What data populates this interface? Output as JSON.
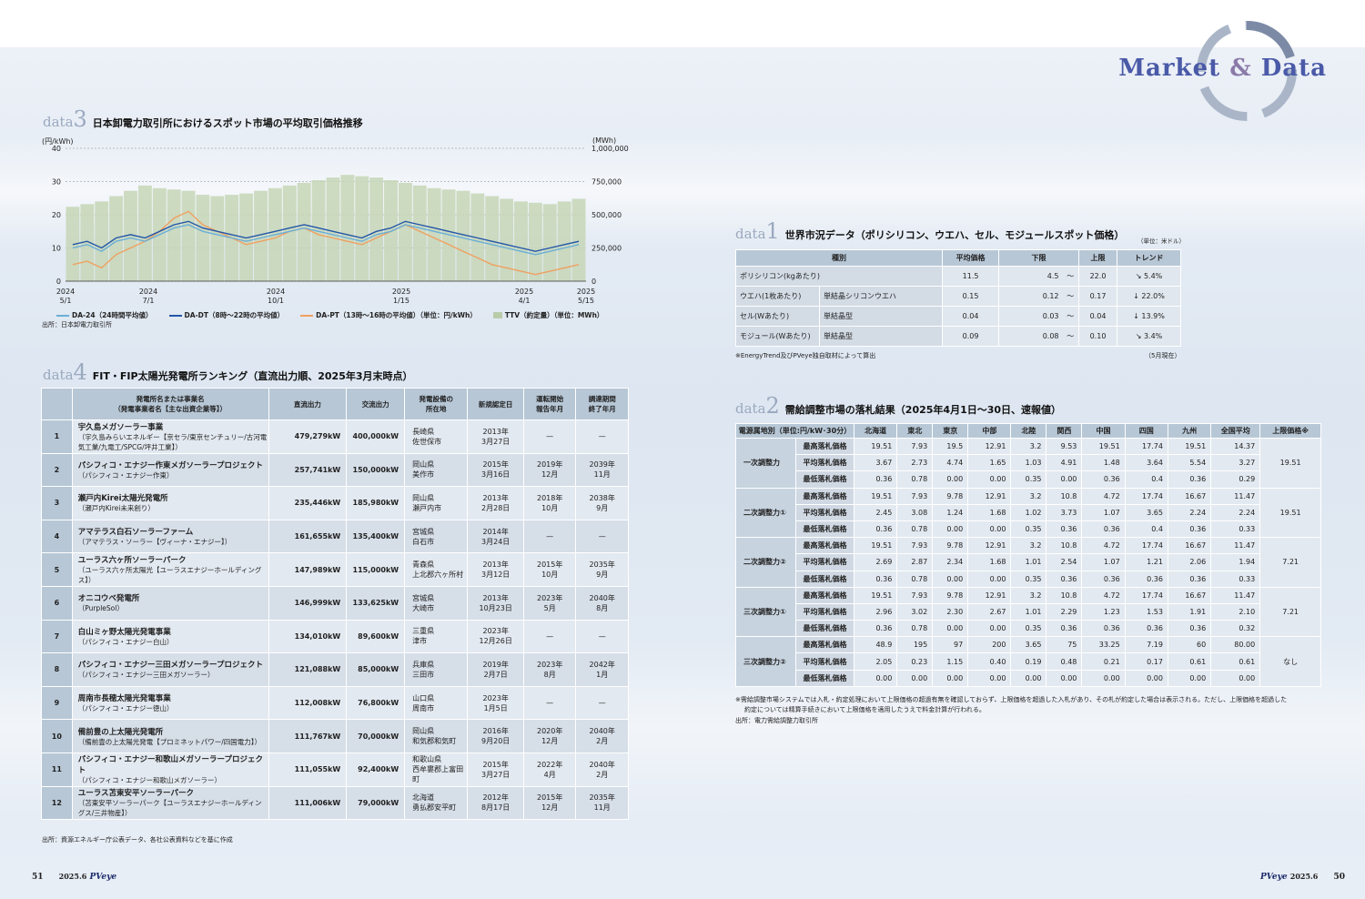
{
  "header": {
    "brand_market": "Market",
    "brand_amp": "&",
    "brand_data": "Data"
  },
  "data3": {
    "tag": "data",
    "num": "3",
    "title": "日本卸電力取引所におけるスポット市場の平均取引価格推移",
    "left_unit": "(円/kWh)",
    "right_unit": "(MWh)",
    "source": "出所：日本卸電力取引所",
    "legend": [
      {
        "label": "DA-24（24時間平均値）",
        "color": "#6aaed6"
      },
      {
        "label": "DA-DT（8時〜22時の平均値）",
        "color": "#2356a8"
      },
      {
        "label": "DA-PT（13時〜16時の平均値）（単位：円/kWh）",
        "color": "#f0a060"
      },
      {
        "label": "TTV（約定量）（単位：MWh）",
        "color": "#b8ccaa"
      }
    ]
  },
  "chart_data": {
    "type": "line",
    "y_left_ticks": [
      "40",
      "30",
      "20",
      "10",
      "0"
    ],
    "y_right_ticks": [
      "1,000,000",
      "750,000",
      "500,000",
      "250,000",
      "0"
    ],
    "ylim_left": [
      0,
      40
    ],
    "ylim_right": [
      0,
      1000000
    ],
    "x_ticks": [
      {
        "year": "2024",
        "date": "5/1"
      },
      {
        "year": "2024",
        "date": "7/1"
      },
      {
        "year": "2024",
        "date": "10/1"
      },
      {
        "year": "2025",
        "date": "1/15"
      },
      {
        "year": "2025",
        "date": "4/1"
      },
      {
        "year": "2025",
        "date": "5/15"
      }
    ],
    "series": [
      {
        "name": "DA-24（24時間平均値）",
        "values": [
          10,
          11,
          9,
          12,
          13,
          12,
          14,
          16,
          17,
          15,
          14,
          13,
          12,
          13,
          14,
          15,
          16,
          15,
          14,
          13,
          12,
          14,
          15,
          17,
          16,
          15,
          14,
          13,
          12,
          11,
          10,
          9,
          8,
          9,
          10,
          11
        ]
      },
      {
        "name": "DA-DT（8時〜22時の平均値）",
        "values": [
          11,
          12,
          10,
          13,
          14,
          13,
          15,
          17,
          18,
          16,
          15,
          14,
          13,
          14,
          15,
          16,
          17,
          16,
          15,
          14,
          13,
          15,
          16,
          18,
          17,
          16,
          15,
          14,
          13,
          12,
          11,
          10,
          9,
          10,
          11,
          12
        ]
      },
      {
        "name": "DA-PT（13時〜16時の平均値）",
        "values": [
          5,
          6,
          4,
          8,
          10,
          12,
          15,
          19,
          21,
          17,
          15,
          13,
          11,
          12,
          13,
          15,
          16,
          14,
          13,
          12,
          11,
          13,
          15,
          17,
          15,
          13,
          11,
          9,
          7,
          5,
          4,
          3,
          2,
          3,
          4,
          5
        ]
      },
      {
        "name": "TTV（約定量）",
        "values": [
          560000,
          580000,
          600000,
          640000,
          680000,
          720000,
          700000,
          690000,
          680000,
          650000,
          640000,
          650000,
          660000,
          680000,
          700000,
          720000,
          740000,
          760000,
          780000,
          800000,
          790000,
          780000,
          760000,
          740000,
          720000,
          700000,
          690000,
          680000,
          660000,
          640000,
          620000,
          600000,
          590000,
          580000,
          600000,
          620000
        ]
      }
    ]
  },
  "data4": {
    "tag": "data",
    "num": "4",
    "title": "FIT・FIP太陽光発電所ランキング（直流出力順、2025年3月末時点）",
    "headers": [
      "",
      "発電所名または事業名\n（発電事業者名【主な出資企業等】）",
      "直流出力",
      "交流出力",
      "発電設備の\n所在地",
      "新規認定日",
      "運転開始\n報告年月",
      "調達期間\n終了年月"
    ],
    "rows": [
      {
        "no": "1",
        "name": "宇久島メガソーラー事業",
        "sub": "（宇久島みらいエネルギー【京セラ/東京センチュリー/古河電気工業/九電工/SPCG/坪井工業】）",
        "dc": "479,279kW",
        "ac": "400,000kW",
        "loc1": "長崎県",
        "loc2": "佐世保市",
        "d1": "2013年",
        "d2": "3月27日",
        "op1": "—",
        "op2": "",
        "end1": "—",
        "end2": ""
      },
      {
        "no": "2",
        "name": "パシフィコ・エナジー作東メガソーラープロジェクト",
        "sub": "（パシフィコ・エナジー作東）",
        "dc": "257,741kW",
        "ac": "150,000kW",
        "loc1": "岡山県",
        "loc2": "美作市",
        "d1": "2015年",
        "d2": "3月16日",
        "op1": "2019年",
        "op2": "12月",
        "end1": "2039年",
        "end2": "11月"
      },
      {
        "no": "3",
        "name": "瀬戸内Kirei太陽光発電所",
        "sub": "（瀬戸内Kirei未来創り）",
        "dc": "235,446kW",
        "ac": "185,980kW",
        "loc1": "岡山県",
        "loc2": "瀬戸内市",
        "d1": "2013年",
        "d2": "2月28日",
        "op1": "2018年",
        "op2": "10月",
        "end1": "2038年",
        "end2": "9月"
      },
      {
        "no": "4",
        "name": "アマテラス白石ソーラーファーム",
        "sub": "（アマテラス・ソーラー【ヴィーナ・エナジー】）",
        "dc": "161,655kW",
        "ac": "135,400kW",
        "loc1": "宮城県",
        "loc2": "白石市",
        "d1": "2014年",
        "d2": "3月24日",
        "op1": "—",
        "op2": "",
        "end1": "—",
        "end2": ""
      },
      {
        "no": "5",
        "name": "ユーラス六ヶ所ソーラーパーク",
        "sub": "（ユーラス六ヶ所太陽光【ユーラスエナジーホールディングス】）",
        "dc": "147,989kW",
        "ac": "115,000kW",
        "loc1": "青森県",
        "loc2": "上北郡六ヶ所村",
        "d1": "2013年",
        "d2": "3月12日",
        "op1": "2015年",
        "op2": "10月",
        "end1": "2035年",
        "end2": "9月"
      },
      {
        "no": "6",
        "name": "オニコウベ発電所",
        "sub": "（PurpleSol）",
        "dc": "146,999kW",
        "ac": "133,625kW",
        "loc1": "宮城県",
        "loc2": "大崎市",
        "d1": "2013年",
        "d2": "10月23日",
        "op1": "2023年",
        "op2": "5月",
        "end1": "2040年",
        "end2": "8月"
      },
      {
        "no": "7",
        "name": "白山ミヶ野太陽光発電事業",
        "sub": "（パシフィコ・エナジー白山）",
        "dc": "134,010kW",
        "ac": "89,600kW",
        "loc1": "三重県",
        "loc2": "津市",
        "d1": "2023年",
        "d2": "12月26日",
        "op1": "—",
        "op2": "",
        "end1": "—",
        "end2": ""
      },
      {
        "no": "8",
        "name": "パシフィコ・エナジー三田メガソーラープロジェクト",
        "sub": "（パシフィコ・エナジー三田メガソーラー）",
        "dc": "121,088kW",
        "ac": "85,000kW",
        "loc1": "兵庫県",
        "loc2": "三田市",
        "d1": "2019年",
        "d2": "2月7日",
        "op1": "2023年",
        "op2": "8月",
        "end1": "2042年",
        "end2": "1月"
      },
      {
        "no": "9",
        "name": "周南市長穂太陽光発電事業",
        "sub": "（パシフィコ・エナジー徳山）",
        "dc": "112,008kW",
        "ac": "76,800kW",
        "loc1": "山口県",
        "loc2": "周南市",
        "d1": "2023年",
        "d2": "1月5日",
        "op1": "—",
        "op2": "",
        "end1": "—",
        "end2": ""
      },
      {
        "no": "10",
        "name": "備前豊の上太陽光発電所",
        "sub": "（備前豊の上太陽光発電【プロミネットパワー/四国電力】）",
        "dc": "111,767kW",
        "ac": "70,000kW",
        "loc1": "岡山県",
        "loc2": "和気郡和気町",
        "d1": "2016年",
        "d2": "9月20日",
        "op1": "2020年",
        "op2": "12月",
        "end1": "2040年",
        "end2": "2月"
      },
      {
        "no": "11",
        "name": "パシフィコ・エナジー和歌山メガソーラープロジェクト",
        "sub": "（パシフィコ・エナジー和歌山メガソーラー）",
        "dc": "111,055kW",
        "ac": "92,400kW",
        "loc1": "和歌山県",
        "loc2": "西牟婁郡上富田町",
        "d1": "2015年",
        "d2": "3月27日",
        "op1": "2022年",
        "op2": "4月",
        "end1": "2040年",
        "end2": "2月"
      },
      {
        "no": "12",
        "name": "ユーラス苫東安平ソーラーパーク",
        "sub": "（苫東安平ソーラーパーク【ユーラスエナジーホールディングス/三井物産】）",
        "dc": "111,006kW",
        "ac": "79,000kW",
        "loc1": "北海道",
        "loc2": "勇払郡安平町",
        "d1": "2012年",
        "d2": "8月17日",
        "op1": "2015年",
        "op2": "12月",
        "end1": "2035年",
        "end2": "11月"
      }
    ],
    "source": "出所：資源エネルギー庁公表データ、各社公表資料などを基に作成"
  },
  "data1": {
    "tag": "data",
    "num": "1",
    "title": "世界市況データ（ポリシリコン、ウエハ、セル、モジュールスポット価格）",
    "unit": "（単位：米ドル）",
    "headers": [
      "種別",
      "平均価格",
      "下限",
      "上限",
      "トレンド"
    ],
    "rows": [
      {
        "kind": "ポリシリコン(kgあたり)",
        "sub": "",
        "avg": "11.5",
        "low": "4.5",
        "tilde": "〜",
        "high": "22.0",
        "trend": "↘ 5.4%"
      },
      {
        "kind": "ウエハ(1枚あたり)",
        "sub": "単結晶シリコンウエハ",
        "avg": "0.15",
        "low": "0.12",
        "tilde": "〜",
        "high": "0.17",
        "trend": "↓ 22.0%"
      },
      {
        "kind": "セル(Wあたり)",
        "sub": "単結晶型",
        "avg": "0.04",
        "low": "0.03",
        "tilde": "〜",
        "high": "0.04",
        "trend": "↓ 13.9%"
      },
      {
        "kind": "モジュール(Wあたり)",
        "sub": "単結晶型",
        "avg": "0.09",
        "low": "0.08",
        "tilde": "〜",
        "high": "0.10",
        "trend": "↘ 3.4%"
      }
    ],
    "note": "※EnergyTrend及びPVeye独自取材によって算出",
    "date": "（5月現在）"
  },
  "data2": {
    "tag": "data",
    "num": "2",
    "title": "需給調整市場の落札結果（2025年4月1日〜30日、速報値）",
    "headers": [
      "電源属地別（単位:円/kW･30分）",
      "",
      "北海道",
      "東北",
      "東京",
      "中部",
      "北陸",
      "関西",
      "中国",
      "四国",
      "九州",
      "全国平均",
      "上限価格※"
    ],
    "groups": [
      {
        "name": "一次調整力",
        "upper": "19.51",
        "rows": [
          {
            "item": "最高落札価格",
            "vals": [
              "19.51",
              "7.93",
              "19.5",
              "12.91",
              "3.2",
              "9.53",
              "19.51",
              "17.74",
              "19.51",
              "14.37"
            ]
          },
          {
            "item": "平均落札価格",
            "vals": [
              "3.67",
              "2.73",
              "4.74",
              "1.65",
              "1.03",
              "4.91",
              "1.48",
              "3.64",
              "5.54",
              "3.27"
            ]
          },
          {
            "item": "最低落札価格",
            "vals": [
              "0.36",
              "0.78",
              "0.00",
              "0.00",
              "0.35",
              "0.00",
              "0.36",
              "0.4",
              "0.36",
              "0.29"
            ]
          }
        ]
      },
      {
        "name": "二次調整力①",
        "upper": "19.51",
        "rows": [
          {
            "item": "最高落札価格",
            "vals": [
              "19.51",
              "7.93",
              "9.78",
              "12.91",
              "3.2",
              "10.8",
              "4.72",
              "17.74",
              "16.67",
              "11.47"
            ]
          },
          {
            "item": "平均落札価格",
            "vals": [
              "2.45",
              "3.08",
              "1.24",
              "1.68",
              "1.02",
              "3.73",
              "1.07",
              "3.65",
              "2.24",
              "2.24"
            ]
          },
          {
            "item": "最低落札価格",
            "vals": [
              "0.36",
              "0.78",
              "0.00",
              "0.00",
              "0.35",
              "0.36",
              "0.36",
              "0.4",
              "0.36",
              "0.33"
            ]
          }
        ]
      },
      {
        "name": "二次調整力②",
        "upper": "7.21",
        "rows": [
          {
            "item": "最高落札価格",
            "vals": [
              "19.51",
              "7.93",
              "9.78",
              "12.91",
              "3.2",
              "10.8",
              "4.72",
              "17.74",
              "16.67",
              "11.47"
            ]
          },
          {
            "item": "平均落札価格",
            "vals": [
              "2.69",
              "2.87",
              "2.34",
              "1.68",
              "1.01",
              "2.54",
              "1.07",
              "1.21",
              "2.06",
              "1.94"
            ]
          },
          {
            "item": "最低落札価格",
            "vals": [
              "0.36",
              "0.78",
              "0.00",
              "0.00",
              "0.35",
              "0.36",
              "0.36",
              "0.36",
              "0.36",
              "0.33"
            ]
          }
        ]
      },
      {
        "name": "三次調整力①",
        "upper": "7.21",
        "rows": [
          {
            "item": "最高落札価格",
            "vals": [
              "19.51",
              "7.93",
              "9.78",
              "12.91",
              "3.2",
              "10.8",
              "4.72",
              "17.74",
              "16.67",
              "11.47"
            ]
          },
          {
            "item": "平均落札価格",
            "vals": [
              "2.96",
              "3.02",
              "2.30",
              "2.67",
              "1.01",
              "2.29",
              "1.23",
              "1.53",
              "1.91",
              "2.10"
            ]
          },
          {
            "item": "最低落札価格",
            "vals": [
              "0.36",
              "0.78",
              "0.00",
              "0.00",
              "0.35",
              "0.36",
              "0.36",
              "0.36",
              "0.36",
              "0.32"
            ]
          }
        ]
      },
      {
        "name": "三次調整力②",
        "upper": "なし",
        "rows": [
          {
            "item": "最高落札価格",
            "vals": [
              "48.9",
              "195",
              "97",
              "200",
              "3.65",
              "75",
              "33.25",
              "7.19",
              "60",
              "80.00"
            ]
          },
          {
            "item": "平均落札価格",
            "vals": [
              "2.05",
              "0.23",
              "1.15",
              "0.40",
              "0.19",
              "0.48",
              "0.21",
              "0.17",
              "0.61",
              "0.61"
            ]
          },
          {
            "item": "最低落札価格",
            "vals": [
              "0.00",
              "0.00",
              "0.00",
              "0.00",
              "0.00",
              "0.00",
              "0.00",
              "0.00",
              "0.00",
              "0.00"
            ]
          }
        ]
      }
    ],
    "note1": "※需給調整市場システムでは入札・約定処理において上限価格の超過有無を確認しておらず、上限価格を超過した入札があり、その札が約定した場合は表示される。ただし、上限価格を超過した",
    "note2": "約定については精算手続きにおいて上限価格を適用したうえで料金計算が行われる。",
    "source": "出所：電力需給調整力取引所"
  },
  "footer": {
    "left_page": "51",
    "left_issue": "2025.6",
    "left_mag": "PVeye",
    "right_mag": "PVeye",
    "right_issue": "2025.6",
    "right_page": "50"
  }
}
